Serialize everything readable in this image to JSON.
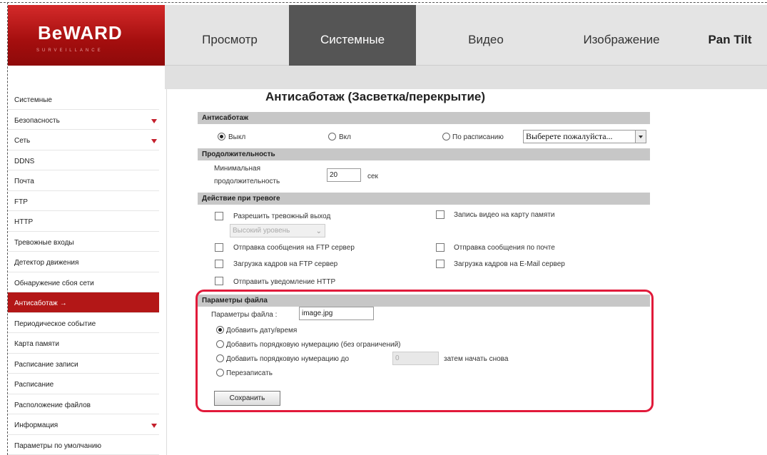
{
  "logo": {
    "text": "BeWARD",
    "subtitle": "SURVEILLANCE"
  },
  "tabs": [
    {
      "label": "Просмотр"
    },
    {
      "label": "Системные"
    },
    {
      "label": "Видео"
    },
    {
      "label": "Изображение"
    },
    {
      "label": "Pan Tilt"
    }
  ],
  "sidebar": {
    "items": [
      {
        "label": "Системные"
      },
      {
        "label": "Безопасность"
      },
      {
        "label": "Сеть"
      },
      {
        "label": "DDNS"
      },
      {
        "label": "Почта"
      },
      {
        "label": "FTP"
      },
      {
        "label": "HTTP"
      },
      {
        "label": "Тревожные входы"
      },
      {
        "label": "Детектор движения"
      },
      {
        "label": "Обнаружение сбоя сети"
      },
      {
        "label": "Антисаботаж",
        "arrow": "→"
      },
      {
        "label": "Периодическое событие"
      },
      {
        "label": "Карта памяти"
      },
      {
        "label": "Расписание записи"
      },
      {
        "label": "Расписание"
      },
      {
        "label": "Расположение файлов"
      },
      {
        "label": "Информация"
      },
      {
        "label": "Параметры по умолчанию"
      }
    ]
  },
  "page": {
    "title": "Антисаботаж (Засветка/перекрытие)"
  },
  "antisabotage": {
    "header": "Антисаботаж",
    "off": "Выкл",
    "on": "Вкл",
    "schedule": "По расписанию",
    "schedule_select": "Выберете пожалуйста..."
  },
  "duration": {
    "header": "Продолжительность",
    "min_label_1": "Минимальная",
    "min_label_2": "продолжительность",
    "value": "20",
    "unit": "сек"
  },
  "actions": {
    "header": "Действие при тревоге",
    "alarm_output": "Разрешить тревожный выход",
    "level_select": "Высокий уровень",
    "record_to_card": "Запись видео на карту памяти",
    "ftp_message": "Отправка сообщения на FTP сервер",
    "mail_message": "Отправка сообщения по почте",
    "ftp_upload": "Загрузка кадров на FTP сервер",
    "email_upload": "Загрузка кадров на E-Mail сервер",
    "http_notify": "Отправить уведомление HTTP"
  },
  "file": {
    "header": "Параметры файла",
    "params_label": "Параметры файла :",
    "filename": "image.jpg",
    "opt_datetime": "Добавить дату/время",
    "opt_seq_unlimited": "Добавить порядковую нумерацию (без ограничений)",
    "opt_seq_until": "Добавить порядковую нумерацию до",
    "seq_value": "0",
    "then_restart": "затем начать снова",
    "opt_overwrite": "Перезаписать",
    "save": "Сохранить"
  }
}
